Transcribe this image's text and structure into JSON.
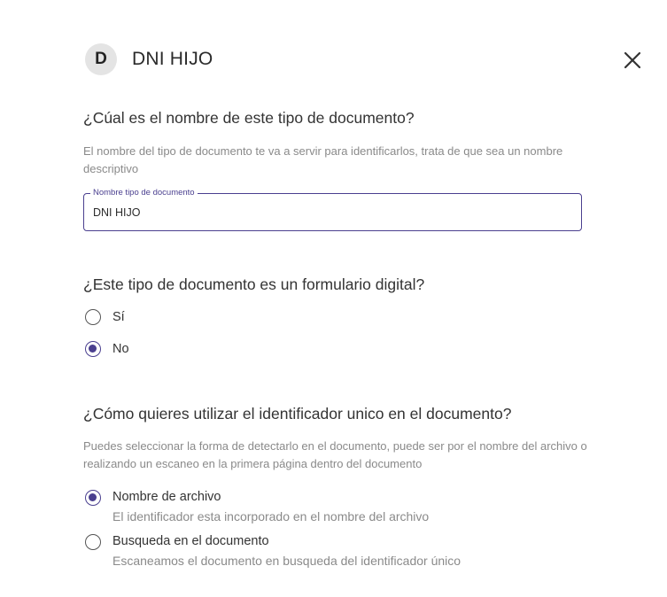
{
  "header": {
    "avatar_letter": "D",
    "title": "DNI HIJO",
    "close_icon": "close-icon"
  },
  "name_section": {
    "question": "¿Cúal es el nombre de este tipo de documento?",
    "help": "El nombre del tipo de documento te va a servir para identificarlos, trata de que sea un nombre descriptivo",
    "field_label": "Nombre tipo de documento",
    "field_value": "DNI HIJO"
  },
  "form_section": {
    "question": "¿Este tipo de documento es un formulario digital?",
    "options": [
      {
        "label": "Sí",
        "checked": false
      },
      {
        "label": "No",
        "checked": true
      }
    ]
  },
  "identifier_section": {
    "question": "¿Cómo quieres utilizar el identificador unico en el documento?",
    "help": "Puedes seleccionar la forma de detectarlo en el documento, puede ser por el nombre del archivo o realizando un escaneo en la primera página dentro del documento",
    "options": [
      {
        "label": "Nombre de archivo",
        "sub": "El identificador esta incorporado en el nombre del archivo",
        "checked": true
      },
      {
        "label": "Busqueda en el documento",
        "sub": "Escaneamos el documento en busqueda del identificador único",
        "checked": false
      }
    ]
  },
  "colors": {
    "accent": "#4a3f8f",
    "avatar_bg": "#e4e4e4",
    "help_text": "#8a8a8a"
  }
}
